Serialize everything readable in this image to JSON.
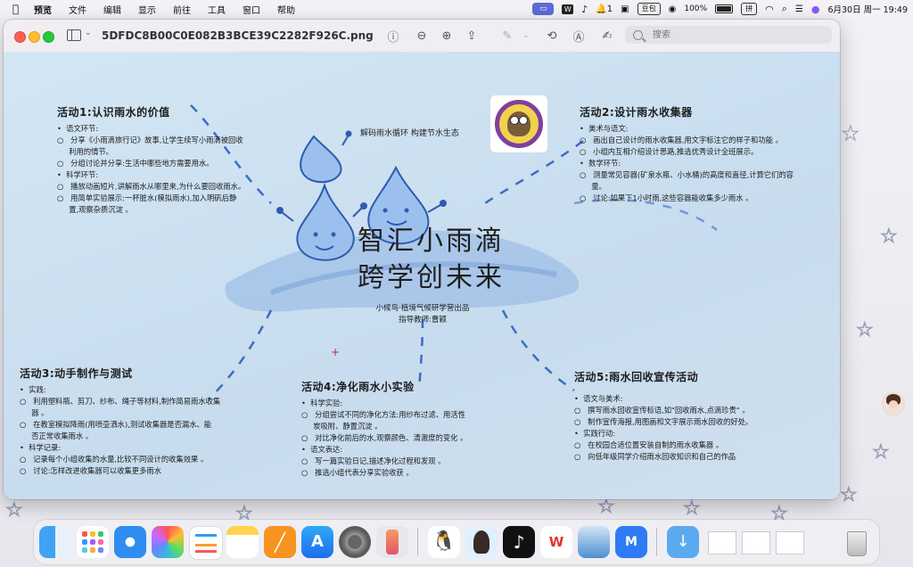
{
  "menubar": {
    "app": "预览",
    "items": [
      "文件",
      "编辑",
      "显示",
      "前往",
      "工具",
      "窗口",
      "帮助"
    ],
    "status": {
      "notification_count": "1",
      "xiaoyi_label": "豆包",
      "battery": "100%",
      "input_method": "拼",
      "datetime": "6月30日 周一  19:49"
    }
  },
  "window": {
    "title": "5DFDC8B00C0E082B3BCE39C2282F926C.png",
    "search_placeholder": "搜索"
  },
  "poster": {
    "title_line1": "智汇小雨滴",
    "title_line2": "跨学创未来",
    "tagline": "解码雨水循环  构建节水生态",
    "credit_line1": "小候鸟·植境气候研学营出品",
    "credit_line2": "指导教师:曹颖",
    "activity1": {
      "title": "活动1:认识雨水的价值",
      "lines": [
        "•  语文环节:",
        "○   分享《小雨滴旅行记》故事,让学生续写小雨滴被回收",
        "     利用的情节。",
        "○   分组讨论并分享:生活中哪些地方需要用水。",
        "•  科学环节:",
        "○   播放动画短片,讲解雨水从哪里来,为什么要回收雨水。",
        "○   用简单实验展示:一杯脏水(模拟雨水),加入明矾后静",
        "     置,观察杂质沉淀 。"
      ]
    },
    "activity2": {
      "title": "活动2:设计雨水收集器",
      "lines": [
        "•  美术与语文:",
        "○   画出自己设计的雨水收集器,用文字标注它的样子和功能 。",
        "○   小组内互相介绍设计思路,推选优秀设计全班展示。",
        "•  数学环节:",
        "○   测量常见容器(矿泉水瓶、小水桶)的高度和直径,计算它们的容",
        "     量。",
        "○   讨论:如果下1小时雨,这些容器能收集多少雨水 。"
      ]
    },
    "activity3": {
      "title": "活动3:动手制作与测试",
      "lines": [
        "•  实践:",
        "○   利用塑料瓶、剪刀、纱布、绳子等材料,制作简易雨水收集",
        "     器 。",
        "○   在教室模拟降雨(用喷壶洒水),测试收集器是否漏水、能",
        "     否正常收集雨水 。",
        "•  科学记录:",
        "○   记录每个小组收集的水量,比较不同设计的收集效果 。",
        "○   讨论:怎样改进收集器可以收集更多雨水"
      ]
    },
    "activity4": {
      "title": "活动4:净化雨水小实验",
      "lines": [
        "•  科学实验:",
        "○   分组尝试不同的净化方法:用纱布过滤、用活性",
        "     炭吸附、静置沉淀 。",
        "○   对比净化前后的水,观察颜色、清澈度的变化 。",
        "",
        "•  语文表达:",
        "○   写一篇实验日记,描述净化过程和发现 。",
        "○   推选小组代表分享实验收获 。"
      ]
    },
    "activity5": {
      "title": "活动5:雨水回收宣传活动",
      "lines": [
        "•  语文与美术:",
        "○   撰写雨水回收宣传标语,如\"回收雨水,点滴珍贵\" 。",
        "○   制作宣传海报,用图画和文字展示雨水回收的好处。",
        "",
        "•  实践行动:",
        "○   在校园合适位置安装自制的雨水收集器 。",
        "○   向低年级同学介绍雨水回收知识和自己的作品"
      ]
    }
  },
  "dock": {
    "apps": [
      "finder",
      "launchpad",
      "safari",
      "photos",
      "reminders",
      "notes",
      "pages",
      "app-store",
      "system-settings",
      "iphone-mirroring",
      "qq",
      "avatar-app",
      "tiktok",
      "wps",
      "preview",
      "tencent-meeting",
      "downloads",
      "recent-files",
      "trash"
    ]
  },
  "colors": {
    "poster_bg": "#cfe2f0",
    "accent": "#3f6fd0",
    "menubar_bg": "#f4f2f6"
  }
}
